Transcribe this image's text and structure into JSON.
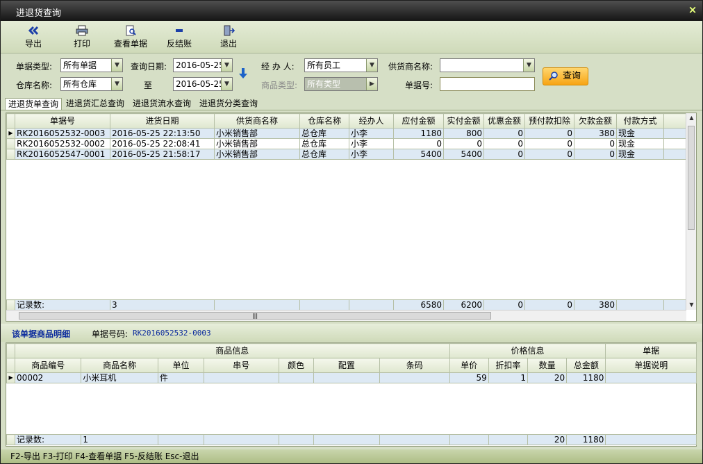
{
  "window": {
    "title": "进退货查询",
    "close_glyph": "×"
  },
  "toolbar": {
    "export": {
      "label": "导出",
      "icon": "double-left-arrow-icon"
    },
    "print": {
      "label": "打印",
      "icon": "printer-icon"
    },
    "view": {
      "label": "查看单据",
      "icon": "document-magnifier-icon"
    },
    "unsettle": {
      "label": "反结账",
      "icon": "minus-icon"
    },
    "exit": {
      "label": "退出",
      "icon": "door-exit-icon"
    }
  },
  "filters": {
    "doc_type_label": "单据类型:",
    "doc_type_value": "所有单据",
    "query_date_label": "查询日期:",
    "date_from": "2016-05-25",
    "handler_label": "经 办 人:",
    "handler_value": "所有员工",
    "supplier_label": "供货商名称:",
    "supplier_value": "",
    "warehouse_label": "仓库名称:",
    "warehouse_value": "所有仓库",
    "to_label": "至",
    "date_to": "2016-05-25",
    "goods_type_label": "商品类型:",
    "goods_type_value": "所有类型",
    "doc_no_label": "单据号:",
    "doc_no_value": "",
    "query_button": "查询"
  },
  "tabs": [
    "进退货单查询",
    "进退货汇总查询",
    "进退货流水查询",
    "进退货分类查询"
  ],
  "main_grid": {
    "columns": [
      "单据号",
      "进货日期",
      "供货商名称",
      "仓库名称",
      "经办人",
      "应付金额",
      "实付金额",
      "优惠金额",
      "预付款扣除",
      "欠款金额",
      "付款方式"
    ],
    "rows": [
      [
        "RK2016052532-0003",
        "2016-05-25 22:13:50",
        "小米销售部",
        "总仓库",
        "小李",
        "1180",
        "800",
        "0",
        "0",
        "380",
        "现金"
      ],
      [
        "RK2016052532-0002",
        "2016-05-25 22:08:41",
        "小米销售部",
        "总仓库",
        "小李",
        "0",
        "0",
        "0",
        "0",
        "0",
        "现金"
      ],
      [
        "RK2016052547-0001",
        "2016-05-25 21:58:17",
        "小米销售部",
        "总仓库",
        "小李",
        "5400",
        "5400",
        "0",
        "0",
        "0",
        "现金"
      ]
    ],
    "summary": {
      "label": "记录数:",
      "count": "3",
      "payable": "6580",
      "paid": "6200",
      "discount": "0",
      "prepay": "0",
      "owed": "380"
    }
  },
  "detail": {
    "title": "该单据商品明细",
    "doc_no_label": "单据号码:",
    "doc_no_value": "RK2016052532-0003",
    "group_headers": {
      "goods": "商品信息",
      "price": "价格信息",
      "doc": "单据"
    },
    "columns": [
      "商品编号",
      "商品名称",
      "单位",
      "串号",
      "颜色",
      "配置",
      "条码",
      "单价",
      "折扣率",
      "数量",
      "总金额",
      "单据说明"
    ],
    "rows": [
      [
        "00002",
        "小米耳机",
        "件",
        "",
        "",
        "",
        "",
        "59",
        "1",
        "20",
        "1180",
        ""
      ]
    ],
    "summary": {
      "label": "记录数:",
      "count": "1",
      "qty": "20",
      "total": "1180"
    }
  },
  "statusbar": "F2-导出 F3-打印 F4-查看单据 F5-反结账 Esc-退出"
}
